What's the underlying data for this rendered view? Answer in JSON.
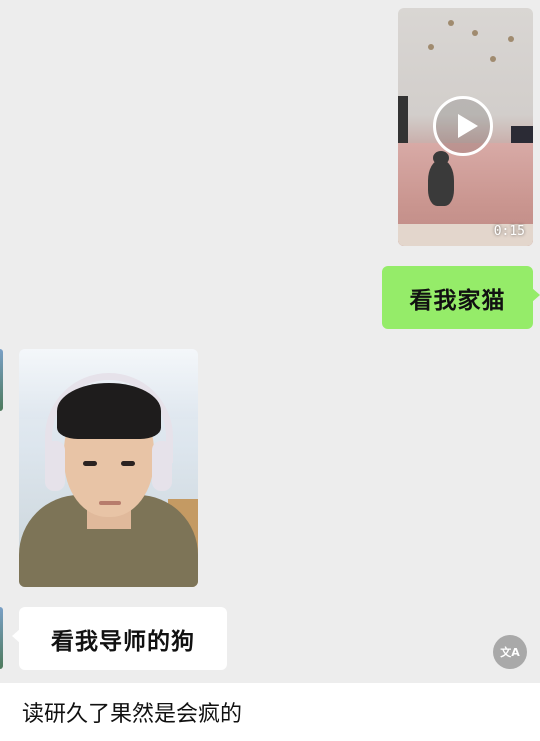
{
  "chat": {
    "messages": [
      {
        "type": "video",
        "direction": "outgoing",
        "duration": "0:15"
      },
      {
        "type": "text",
        "direction": "outgoing",
        "text": "看我家猫"
      },
      {
        "type": "image",
        "direction": "incoming"
      },
      {
        "type": "text",
        "direction": "incoming",
        "text": "看我导师的狗"
      }
    ]
  },
  "translate_button": {
    "icon": "translate-icon",
    "glyph": "文A"
  },
  "caption": "读研久了果然是会疯的",
  "colors": {
    "background": "#ededed",
    "outgoing_bubble": "#95ec69",
    "incoming_bubble": "#ffffff",
    "caption_bg": "#ffffff"
  }
}
